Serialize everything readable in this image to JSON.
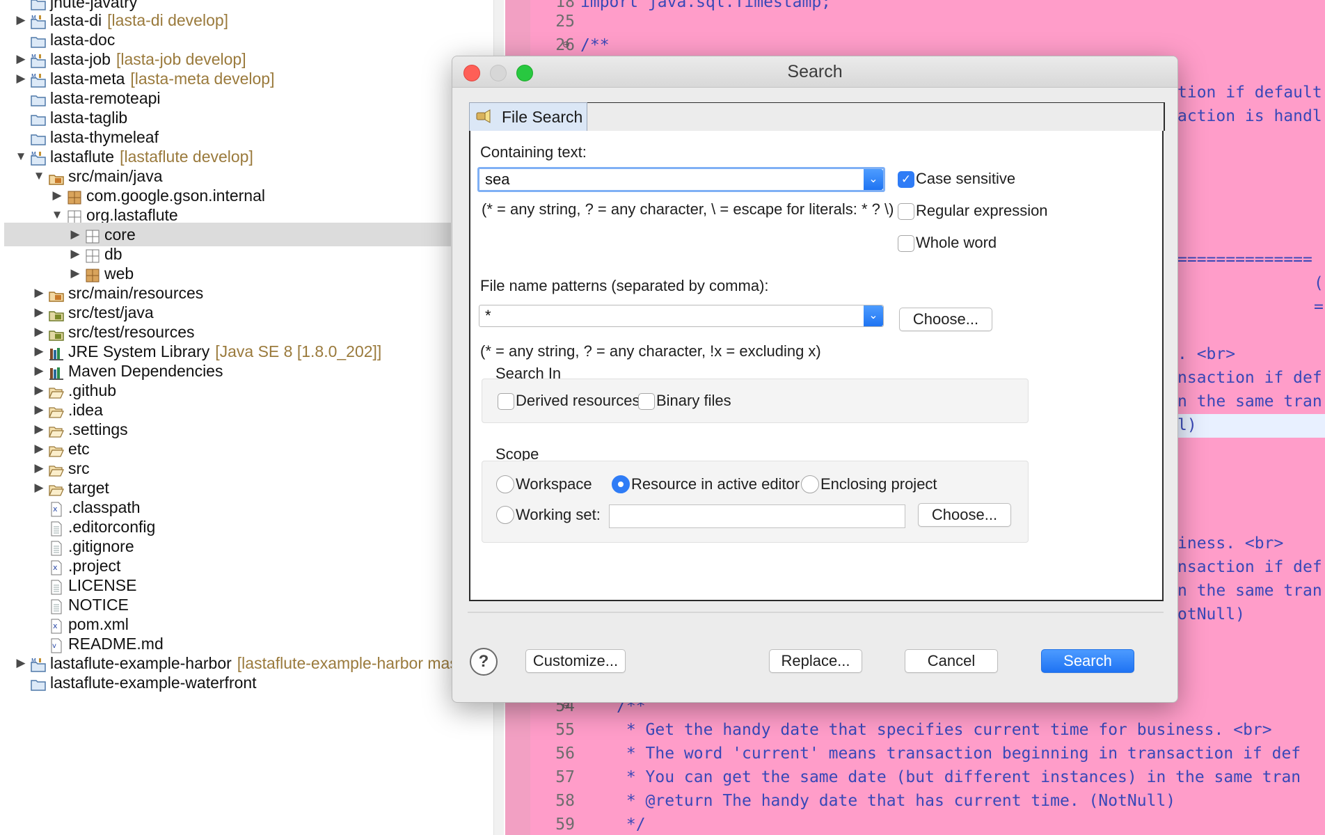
{
  "explorer": {
    "rows": [
      {
        "label": "jnute-javatry",
        "tag": ""
      },
      {
        "label": "lasta-di",
        "tag": "[lasta-di develop]"
      },
      {
        "label": "lasta-doc",
        "tag": ""
      },
      {
        "label": "lasta-job",
        "tag": "[lasta-job develop]"
      },
      {
        "label": "lasta-meta",
        "tag": "[lasta-meta develop]"
      },
      {
        "label": "lasta-remoteapi",
        "tag": ""
      },
      {
        "label": "lasta-taglib",
        "tag": ""
      },
      {
        "label": "lasta-thymeleaf",
        "tag": ""
      },
      {
        "label": "lastaflute",
        "tag": "[lastaflute develop]"
      },
      {
        "label": "src/main/java",
        "tag": ""
      },
      {
        "label": "com.google.gson.internal",
        "tag": ""
      },
      {
        "label": "org.lastaflute",
        "tag": ""
      },
      {
        "label": "core",
        "tag": ""
      },
      {
        "label": "db",
        "tag": ""
      },
      {
        "label": "web",
        "tag": ""
      },
      {
        "label": "src/main/resources",
        "tag": ""
      },
      {
        "label": "src/test/java",
        "tag": ""
      },
      {
        "label": "src/test/resources",
        "tag": ""
      },
      {
        "label": "JRE System Library",
        "tag": "[Java SE 8 [1.8.0_202]]"
      },
      {
        "label": "Maven Dependencies",
        "tag": ""
      },
      {
        "label": ".github",
        "tag": ""
      },
      {
        "label": ".idea",
        "tag": ""
      },
      {
        "label": ".settings",
        "tag": ""
      },
      {
        "label": "etc",
        "tag": ""
      },
      {
        "label": "src",
        "tag": ""
      },
      {
        "label": "target",
        "tag": ""
      },
      {
        "label": ".classpath",
        "tag": ""
      },
      {
        "label": ".editorconfig",
        "tag": ""
      },
      {
        "label": ".gitignore",
        "tag": ""
      },
      {
        "label": ".project",
        "tag": ""
      },
      {
        "label": "LICENSE",
        "tag": ""
      },
      {
        "label": "NOTICE",
        "tag": ""
      },
      {
        "label": "pom.xml",
        "tag": ""
      },
      {
        "label": "README.md",
        "tag": ""
      },
      {
        "label": "lastaflute-example-harbor",
        "tag": "[lastaflute-example-harbor master"
      },
      {
        "label": "lastaflute-example-waterfront",
        "tag": ""
      }
    ]
  },
  "editor": {
    "line_numbers": [
      "18",
      "25",
      "26",
      "54",
      "55",
      "56",
      "57",
      "58",
      "59"
    ],
    "lines": {
      "l18": "import java.sql.Timestamp;",
      "l26": "/**",
      "r1": "tion if default",
      "r2": "action is handl",
      "r3": "==============",
      "r4": "(",
      "r5": "=",
      "r6": ". <br>",
      "r7": "nsaction if def",
      "r8": "n the same tran",
      "r9": "l)",
      "r10": "iness. <br>",
      "r11": "nsaction if def",
      "r12": "n the same tran",
      "r13": "otNull)",
      "l54": "/**",
      "l55": " * Get the handy date that specifies current time for business. <br>",
      "l56": " * The word 'current' means transaction beginning in transaction if def",
      "l57": " * You can get the same date (but different instances) in the same tran",
      "l58": " * @return The handy date that has current time. (NotNull)",
      "l59": " */"
    }
  },
  "dialog": {
    "title": "Search",
    "tab_label": "File Search",
    "containing_label": "Containing text:",
    "containing_value": "sea",
    "containing_hint": "(* = any string, ? = any character, \\ = escape for literals: * ? \\)",
    "case_sensitive": "Case sensitive",
    "regex": "Regular expression",
    "whole_word": "Whole word",
    "patterns_label": "File name patterns (separated by comma):",
    "patterns_value": "*",
    "patterns_hint": "(* = any string, ? = any character, !x = excluding x)",
    "choose": "Choose...",
    "search_in": "Search In",
    "derived": "Derived resources",
    "binary": "Binary files",
    "scope": "Scope",
    "workspace": "Workspace",
    "resource_active": "Resource in active editor",
    "enclosing": "Enclosing project",
    "working_set": "Working set:",
    "customize": "Customize...",
    "replace": "Replace...",
    "cancel": "Cancel",
    "search_btn": "Search",
    "help": "?"
  },
  "colors": {
    "editor_bg": "#ff9dc9",
    "accent": "#2f7cf6",
    "tag": "#9a7a3c"
  }
}
